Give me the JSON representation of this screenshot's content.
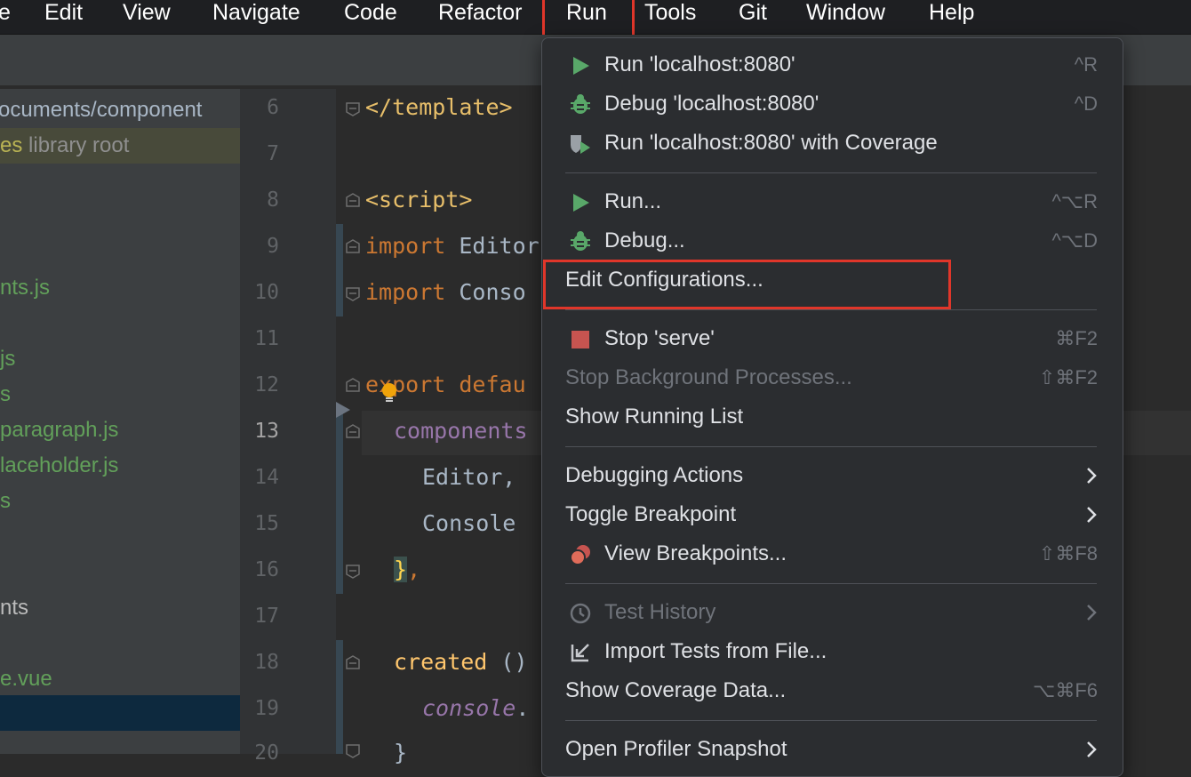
{
  "menubar": {
    "items": [
      "e",
      "Edit",
      "View",
      "Navigate",
      "Code",
      "Refactor",
      "Run",
      "Tools",
      "Git",
      "Window",
      "Help"
    ]
  },
  "project_tree": {
    "rows": [
      "ocuments/component",
      "es",
      "library root",
      "nts.js",
      "js",
      "s",
      "paragraph.js",
      "laceholder.js",
      "s",
      "nts",
      "e.vue"
    ]
  },
  "editor": {
    "line_numbers": [
      "6",
      "7",
      "8",
      "9",
      "10",
      "11",
      "12",
      "13",
      "14",
      "15",
      "16",
      "17",
      "18",
      "19",
      "20"
    ],
    "current_line": "13",
    "lines": {
      "l6": "</template>",
      "l8": "<script>",
      "l9_kw": "import",
      "l9_id": " Editor",
      "l10_kw": "import",
      "l10_id": " Conso",
      "l12_kw": "export defau",
      "l13_prop": "components",
      "l14_id": "Editor,",
      "l15_id": "Console",
      "l16_brace": "}",
      "l16_rest": ",",
      "l18_fn": "created",
      "l18_rest": " ()",
      "l19_ital": "console",
      "l19_rest": ".",
      "l20": "}"
    }
  },
  "run_menu": {
    "items": [
      {
        "label": "Run 'localhost:8080'",
        "icon": "run-icon",
        "shortcut": "^R"
      },
      {
        "label": "Debug 'localhost:8080'",
        "icon": "debug-icon",
        "shortcut": "^D"
      },
      {
        "label": "Run 'localhost:8080' with Coverage",
        "icon": "coverage-icon",
        "shortcut": ""
      },
      {
        "label": "Run...",
        "icon": "run-icon",
        "shortcut": "^⌥R"
      },
      {
        "label": "Debug...",
        "icon": "debug-icon",
        "shortcut": "^⌥D"
      },
      {
        "label": "Edit Configurations...",
        "icon": "",
        "shortcut": ""
      },
      {
        "label": "Stop 'serve'",
        "icon": "stop-icon",
        "shortcut": "⌘F2"
      },
      {
        "label": "Stop Background Processes...",
        "icon": "",
        "shortcut": "⇧⌘F2"
      },
      {
        "label": "Show Running List",
        "icon": "",
        "shortcut": ""
      },
      {
        "label": "Debugging Actions",
        "icon": "",
        "shortcut": ""
      },
      {
        "label": "Toggle Breakpoint",
        "icon": "",
        "shortcut": ""
      },
      {
        "label": "View Breakpoints...",
        "icon": "breakpoints-icon",
        "shortcut": "⇧⌘F8"
      },
      {
        "label": "Test History",
        "icon": "clock-icon",
        "shortcut": ""
      },
      {
        "label": "Import Tests from File...",
        "icon": "import-icon",
        "shortcut": ""
      },
      {
        "label": "Show Coverage Data...",
        "icon": "",
        "shortcut": "⌥⌘F6"
      },
      {
        "label": "Open Profiler Snapshot",
        "icon": "",
        "shortcut": ""
      }
    ]
  },
  "colors": {
    "highlight_box": "#e0362a",
    "run_green": "#59a869",
    "stop_red": "#c75450",
    "menu_bg": "#2b2d30"
  }
}
